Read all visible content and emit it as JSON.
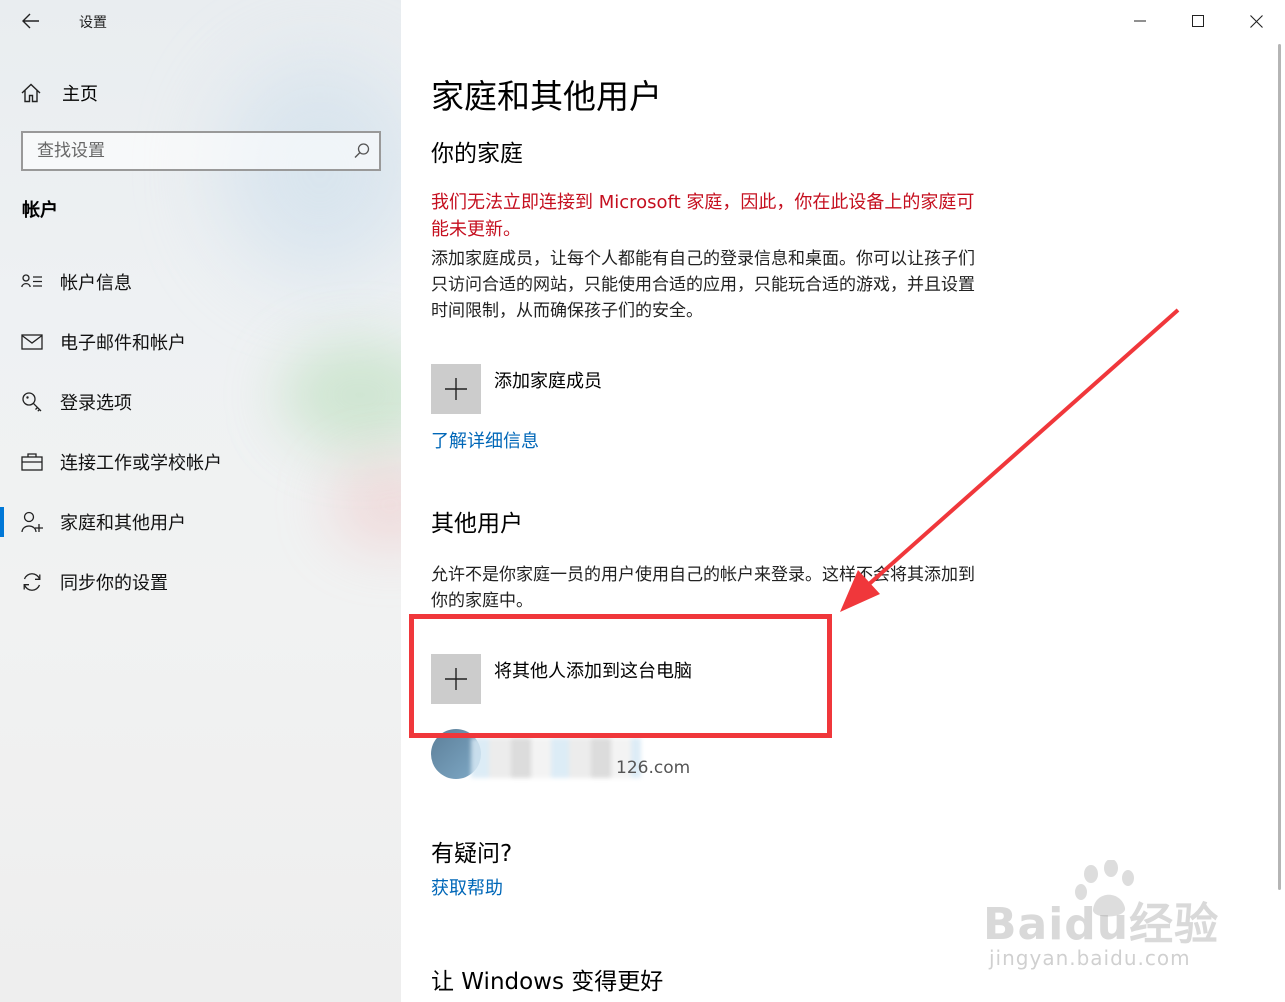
{
  "window": {
    "title": "设置"
  },
  "sidebar": {
    "home_label": "主页",
    "search_placeholder": "查找设置",
    "section_title": "帐户",
    "items": [
      {
        "label": "帐户信息",
        "icon": "account-info-icon",
        "active": false
      },
      {
        "label": "电子邮件和帐户",
        "icon": "mail-icon",
        "active": false
      },
      {
        "label": "登录选项",
        "icon": "key-icon",
        "active": false
      },
      {
        "label": "连接工作或学校帐户",
        "icon": "briefcase-icon",
        "active": false
      },
      {
        "label": "家庭和其他用户",
        "icon": "family-user-icon",
        "active": true
      },
      {
        "label": "同步你的设置",
        "icon": "sync-icon",
        "active": false
      }
    ]
  },
  "main": {
    "page_title": "家庭和其他用户",
    "family": {
      "heading": "你的家庭",
      "warning": "我们无法立即连接到 Microsoft 家庭，因此，你在此设备上的家庭可能未更新。",
      "description": "添加家庭成员，让每个人都能有自己的登录信息和桌面。你可以让孩子们只访问合适的网站，只能使用合适的应用，只能玩合适的游戏，并且设置时间限制，从而确保孩子们的安全。",
      "add_label": "添加家庭成员",
      "learn_more": "了解详细信息"
    },
    "others": {
      "heading": "其他用户",
      "description_part1": "允许不是你家庭一员的用户使用自己的帐户来登录。这",
      "description_part2": "样不会将其添加到你的家庭中。",
      "add_label": "将其他人添加到这台电脑",
      "user_email_suffix": "126.com"
    },
    "help": {
      "heading": "有疑问?",
      "link": "获取帮助"
    },
    "improve": {
      "heading": "让 Windows 变得更好"
    }
  },
  "watermark": {
    "brand": "Baidu经验",
    "url": "jingyan.baidu.com"
  },
  "colors": {
    "accent": "#0078d7",
    "link": "#0067b8",
    "warning": "#c50f1f",
    "annotation": "#f0373b"
  }
}
